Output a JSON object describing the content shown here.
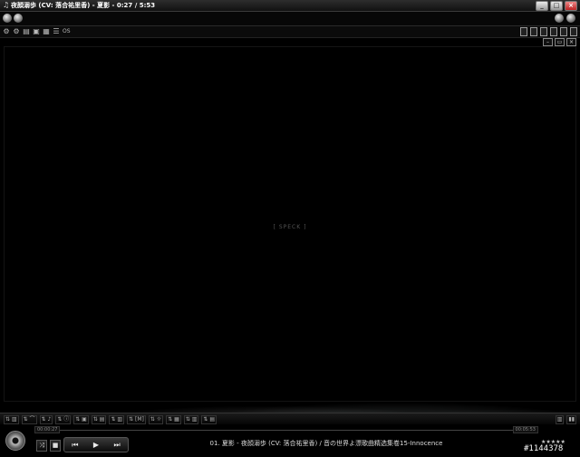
{
  "window": {
    "title": "夜顔溺歩 (CV: 落合祐里香) - 夏影 - 0:27 / 5:53"
  },
  "toolbar": {
    "osd_label": "OS"
  },
  "video": {
    "placeholder": "[ SPECK ]"
  },
  "controls": {
    "elapsed": "00:00:27",
    "remaining": "00:05:53",
    "play_icon": "▶",
    "prev_icon": "⏮",
    "next_icon": "⏭",
    "stop_icon": "■",
    "shuffle_icon": "⤨"
  },
  "now_playing": {
    "track": "01. 夏影 - 夜顔溺歩 (CV: 落合祐里香) / 音の世界よ漂歌曲精选集卷15-Innocence"
  },
  "rating": {
    "stars": "★★★★★"
  },
  "watermark": {
    "text": "#1144378"
  },
  "colors": {
    "background": "#000000",
    "chrome": "#1b1b1b",
    "text": "#dddddd"
  }
}
